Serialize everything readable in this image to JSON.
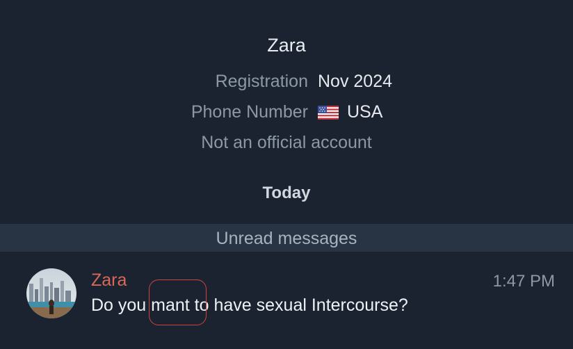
{
  "profile": {
    "name": "Zara",
    "registration_label": "Registration",
    "registration_value": "Nov 2024",
    "phone_label": "Phone Number",
    "phone_country": "USA",
    "phone_flag_icon": "us-flag-icon",
    "account_note": "Not an official account"
  },
  "date_divider": "Today",
  "unread_label": "Unread messages",
  "message": {
    "sender": "Zara",
    "time": "1:47 PM",
    "text": "Do you mant to have sexual Intercourse?",
    "avatar_icon": "avatar-photo",
    "sender_color": "#d8685a"
  },
  "annotation": {
    "highlight_color": "#d1443a"
  }
}
